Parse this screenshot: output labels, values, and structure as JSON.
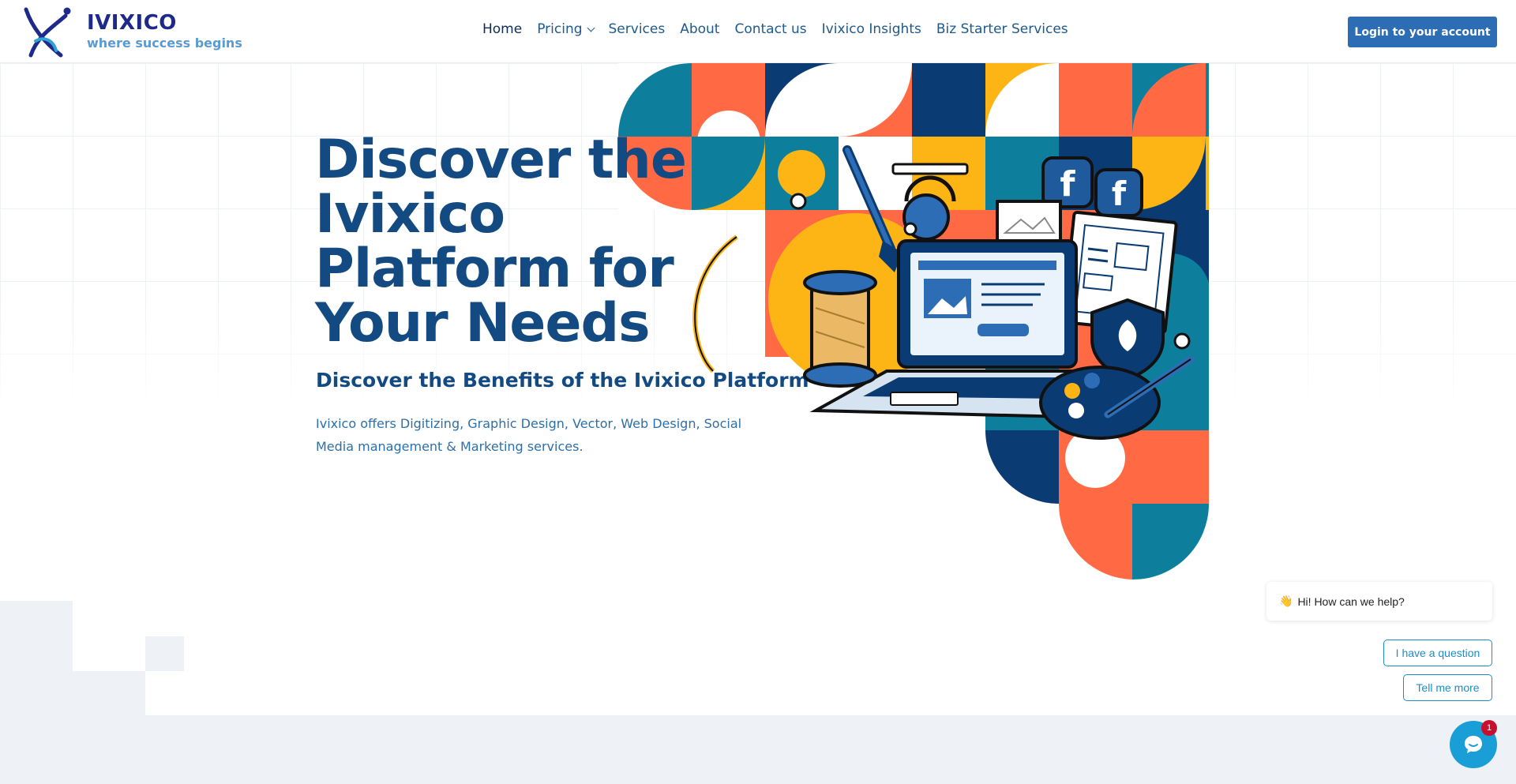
{
  "brand": {
    "name": "IVIXICO",
    "tagline": "where success begins",
    "logo_icon": "ivixico-logo-icon"
  },
  "nav": {
    "items": [
      {
        "label": "Home",
        "active": true
      },
      {
        "label": "Pricing",
        "has_dropdown": true
      },
      {
        "label": "Services"
      },
      {
        "label": "About"
      },
      {
        "label": "Contact us"
      },
      {
        "label": "Ivixico Insights"
      },
      {
        "label": "Biz Starter Services"
      }
    ],
    "dropdown_icon": "chevron-down-icon"
  },
  "header": {
    "login_label": "Login to your account"
  },
  "hero": {
    "title": "Discover the Ivixico Platform for Your Needs",
    "subtitle": "Discover the Benefits of the Ivixico Platform",
    "description": "Ivixico offers Digitizing, Graphic Design, Vector, Web Design, Social Media management & Marketing services.",
    "illustration_icons": [
      "laptop-icon",
      "paintbrush-icon",
      "thread-spool-icon",
      "facebook-icon",
      "shield-leaf-icon",
      "palette-icon",
      "headset-icon",
      "document-icon"
    ]
  },
  "chat": {
    "greeting_emoji": "👋",
    "greeting": "Hi! How can we help?",
    "options": [
      "I have a question",
      "Tell me more"
    ],
    "badge_count": "1",
    "launcher_icon": "chat-bubble-icon"
  },
  "colors": {
    "primary": "#134a82",
    "accent_blue": "#2d6db5",
    "chat_blue": "#1a9ed8",
    "orange": "#ff6a45",
    "yellow": "#fdb515",
    "teal": "#0d7f9c",
    "navy": "#0b3b73"
  }
}
